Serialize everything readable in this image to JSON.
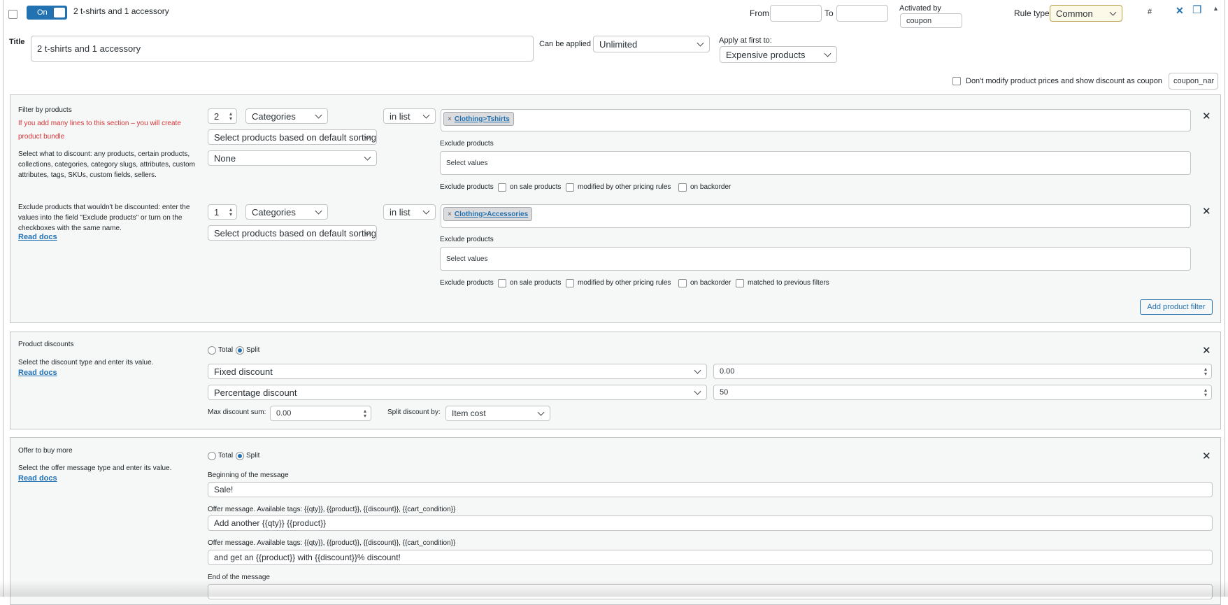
{
  "header": {
    "toggle_label": "On",
    "rule_name": "2 t-shirts and 1 accessory",
    "from_label": "From",
    "to_label": "To",
    "activated_by_label": "Activated by",
    "activated_by_value": "coupon",
    "rule_type_label": "Rule type",
    "rule_type_value": "Common",
    "hash_label": "#",
    "close_glyph": "✕",
    "copy_glyph": "❐",
    "collapse_glyph": "▲"
  },
  "title_row": {
    "title_label": "Title",
    "title_value": "2 t-shirts and 1 accessory",
    "can_be_applied_label": "Can be applied",
    "can_be_applied_value": "Unlimited",
    "apply_first_label": "Apply at first to:",
    "apply_first_value": "Expensive products",
    "dont_modify_label": "Don't modify product prices and show discount as coupon",
    "coupon_name_value": "coupon_nar"
  },
  "filter_section": {
    "heading": "Filter by products",
    "warning": "If you add many lines to this section – you will create product bundle",
    "desc1": "Select what to discount: any products, certain products, collections, categories, category slugs, attributes, custom attributes, tags, SKUs, custom fields, sellers.",
    "desc2": "Exclude products that wouldn't be discounted: enter the values into the field \"Exclude products\" or turn on the checkboxes with the same name.",
    "read_docs": "Read docs",
    "filters": [
      {
        "qty": "2",
        "type": "Categories",
        "sorting": "Select products based on default sorting",
        "extra": "None",
        "method": "in list",
        "chip": "Clothing>Tshirts",
        "exclude_label": "Exclude products",
        "exclude_placeholder": "Select values",
        "cb_exclude": "Exclude products",
        "cb_sale": "on sale products",
        "cb_modified": "modified by other pricing rules",
        "cb_backorder": "on backorder"
      },
      {
        "qty": "1",
        "type": "Categories",
        "sorting": "Select products based on default sorting",
        "method": "in list",
        "chip": "Clothing>Accessories",
        "exclude_label": "Exclude products",
        "exclude_placeholder": "Select values",
        "cb_exclude": "Exclude products",
        "cb_sale": "on sale products",
        "cb_modified": "modified by other pricing rules",
        "cb_backorder": "on backorder",
        "cb_matched": "matched to previous filters"
      }
    ],
    "add_button": "Add product filter",
    "remove_glyph": "✕"
  },
  "discount_section": {
    "heading": "Product discounts",
    "desc": "Select the discount type and enter its value.",
    "read_docs": "Read docs",
    "radio_total": "Total",
    "radio_split": "Split",
    "rows": [
      {
        "type": "Fixed discount",
        "value": "0.00"
      },
      {
        "type": "Percentage discount",
        "value": "50"
      }
    ],
    "max_label": "Max discount sum:",
    "max_value": "0.00",
    "split_by_label": "Split discount by:",
    "split_by_value": "Item cost",
    "remove_glyph": "✕"
  },
  "offer_section": {
    "heading": "Offer to buy more",
    "desc": "Select the offer message type and enter its value.",
    "read_docs": "Read docs",
    "radio_total": "Total",
    "radio_split": "Split",
    "begin_label": "Beginning of the message",
    "begin_value": "Sale!",
    "offer_label_1": "Offer message. Available tags: {{qty}}, {{product}}, {{discount}}, {{cart_condition}}",
    "offer_value_1": "Add another {{qty}} {{product}}",
    "offer_label_2": "Offer message. Available tags: {{qty}}, {{product}}, {{discount}}, {{cart_condition}}",
    "offer_value_2": "and get an {{product}} with {{discount}}% discount!",
    "end_label": "End of the message",
    "end_value": "",
    "remove_glyph": "✕"
  },
  "colors": {
    "accent": "#2271b1",
    "warning": "#d63638",
    "rule_type_bg": "#fcf9e8"
  }
}
